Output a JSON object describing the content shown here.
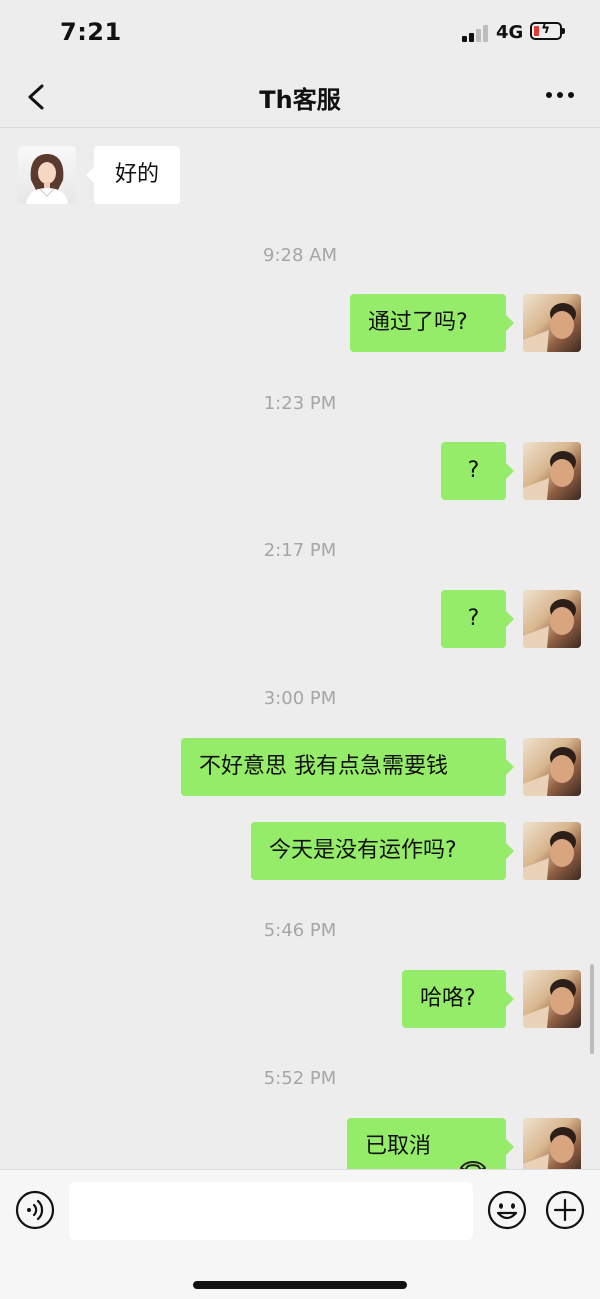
{
  "status_bar": {
    "time": "7:21",
    "network": "4G",
    "battery_icon": "battery-low-charging-icon",
    "signal_icon": "cell-signal-icon"
  },
  "nav": {
    "title": "Th客服",
    "back_icon": "chevron-left-icon",
    "more_icon": "ellipsis-icon"
  },
  "chat": {
    "received": [
      {
        "text": "好的"
      }
    ],
    "timestamps": [
      "9:28 AM",
      "1:23 PM",
      "2:17 PM",
      "3:00 PM",
      "5:46 PM",
      "5:52 PM"
    ],
    "sent": [
      {
        "text": "通过了吗?"
      },
      {
        "text": "?"
      },
      {
        "text": "?"
      },
      {
        "text": "不好意思 我有点急需要钱"
      },
      {
        "text": "今天是没有运作吗?"
      },
      {
        "text": "哈咯?"
      },
      {
        "text": "已取消",
        "icon": "phone-hangup-icon"
      }
    ]
  },
  "input_bar": {
    "message_value": "",
    "voice_icon": "voice-input-icon",
    "emoji_icon": "emoji-icon",
    "plus_icon": "plus-circle-icon"
  },
  "colors": {
    "background": "#ededed",
    "sent_bubble": "#95ec69",
    "received_bubble": "#ffffff",
    "timestamp_text": "#a6a6a6"
  }
}
